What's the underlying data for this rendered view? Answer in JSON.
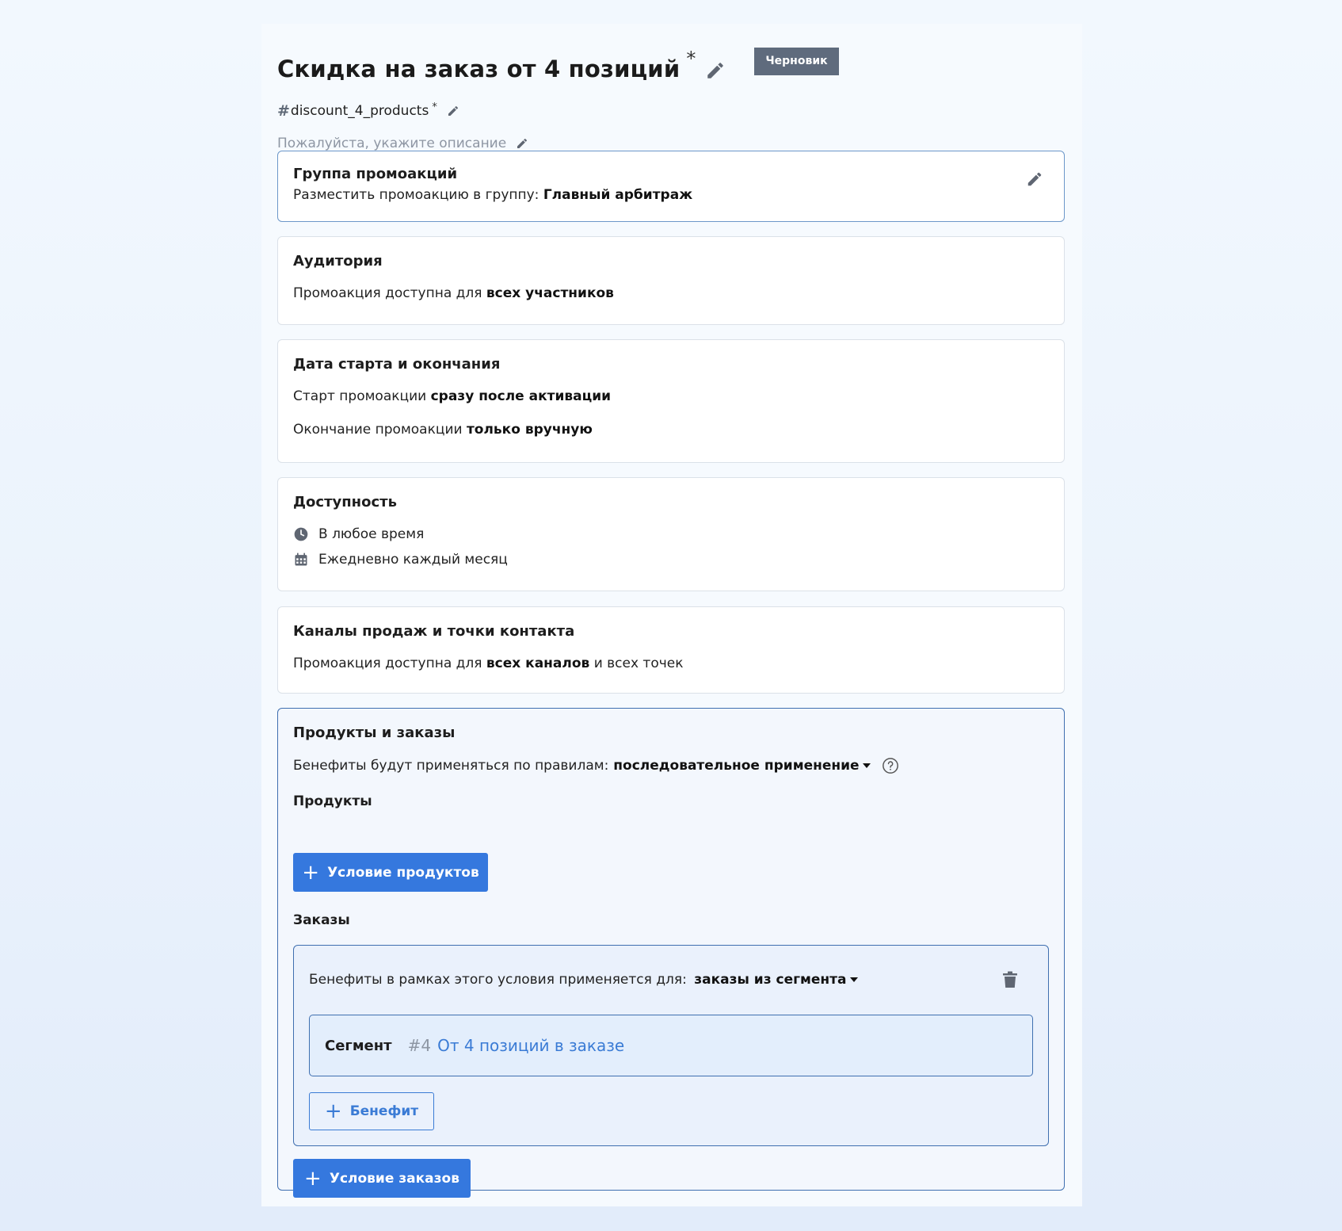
{
  "header": {
    "title": "Скидка на заказ от 4 позиций",
    "required_mark": "*",
    "status_badge": "Черновик",
    "code_hash": "#",
    "code": "discount_4_products",
    "code_required_mark": "*",
    "description_placeholder": "Пожалуйста, укажите описание"
  },
  "promo_group": {
    "title": "Группа промоакций",
    "text": "Разместить промоакцию в группу:",
    "value": "Главный арбитраж"
  },
  "audience": {
    "title": "Аудитория",
    "text": "Промоакция доступна для",
    "value": "всех участников"
  },
  "dates": {
    "title": "Дата старта и окончания",
    "start_text": "Старт промоакции",
    "start_value": "сразу после активации",
    "end_text": "Окончание промоакции",
    "end_value": "только вручную"
  },
  "availability": {
    "title": "Доступность",
    "time": "В любое время",
    "schedule": "Ежедневно каждый месяц"
  },
  "channels": {
    "title": "Каналы продаж и точки контакта",
    "text": "Промоакция доступна для",
    "value": "всех каналов",
    "suffix": "и всех точек"
  },
  "products_orders": {
    "title": "Продукты и заказы",
    "rules_text": "Бенефиты будут применяться по правилам:",
    "rules_value": "последовательное применение",
    "products_heading": "Продукты",
    "add_product_condition": "Условие продуктов",
    "orders_heading": "Заказы",
    "order_condition": {
      "text": "Бенефиты в рамках этого условия применяется для:",
      "value": "заказы из сегмента",
      "segment_label": "Сегмент",
      "segment_number": "#4",
      "segment_name": "От 4 позиций в заказе",
      "add_benefit": "Бенефит"
    },
    "add_order_condition": "Условие заказов"
  },
  "colors": {
    "primary": "#3578de",
    "badge": "#5f6b7d",
    "border_active": "#3f6fb0"
  }
}
